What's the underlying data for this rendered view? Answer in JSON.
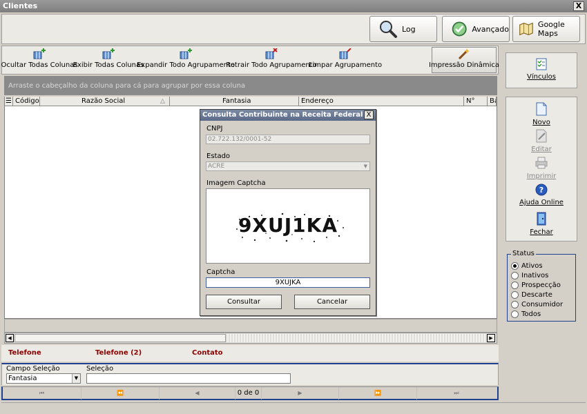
{
  "window": {
    "title": "Clientes",
    "close_label": "X"
  },
  "top_buttons": {
    "log": {
      "label": "Log",
      "icon": "magnifier-icon"
    },
    "avancado": {
      "label": "Avançado",
      "icon": "globe-check-icon"
    },
    "maps": {
      "label": "Google Maps",
      "icon": "map-icon"
    }
  },
  "toolbar": {
    "ocultar": "Ocultar Todas Colunas",
    "exibir": "Exibir Todas Colunas",
    "expandir": "Expandir Todo Agrupamento",
    "retrair": "Retrair Todo Agrupamento",
    "limpar": "Limpar Agrupamento",
    "impressao": "Impressão Dinâmica"
  },
  "grid": {
    "group_hint": "Arraste o cabeçalho da coluna para cá para agrupar por essa coluna",
    "columns": [
      "Código",
      "Razão Social",
      "Fantasia",
      "Endereço",
      "N°",
      "Ba"
    ]
  },
  "contacts": {
    "telefone": "Telefone",
    "telefone2": "Telefone (2)",
    "contato": "Contato"
  },
  "filter": {
    "campo_label": "Campo Seleção",
    "campo_value": "Fantasia",
    "selecao_label": "Seleção",
    "selecao_value": ""
  },
  "nav": {
    "record_count": "0 de 0"
  },
  "sidebar": {
    "vinculos": "Vínculos",
    "novo": "Novo",
    "editar": "Editar",
    "imprimir": "Imprimir",
    "ajuda": "Ajuda Online",
    "fechar": "Fechar"
  },
  "status": {
    "legend": "Status",
    "options": [
      "Ativos",
      "Inativos",
      "Prospecção",
      "Descarte",
      "Consumidor",
      "Todos"
    ],
    "selected": "Ativos"
  },
  "modal": {
    "title": "Consulta Contribuinte na Receita Federal",
    "close_label": "X",
    "cnpj_label": "CNPJ",
    "cnpj_value": "02.722.132/0001-52",
    "estado_label": "Estado",
    "estado_value": "ACRE",
    "imagem_label": "Imagem Captcha",
    "captcha_image_text": "9XUJ1KA",
    "captcha_label": "Captcha",
    "captcha_value": "9XUJKA",
    "consultar": "Consultar",
    "cancelar": "Cancelar"
  }
}
